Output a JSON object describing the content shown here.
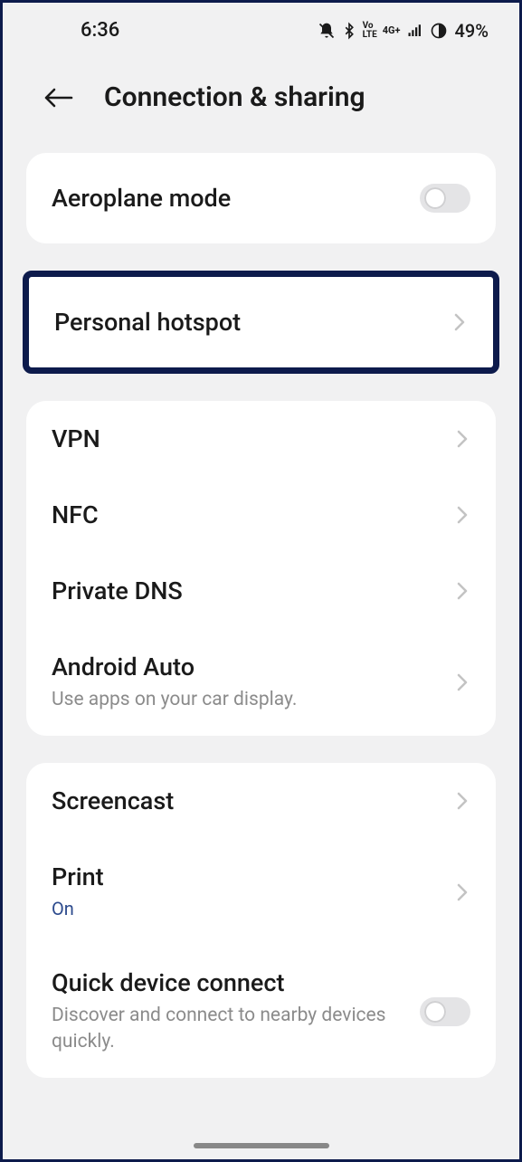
{
  "statusbar": {
    "time": "6:36",
    "battery": "49%"
  },
  "header": {
    "title": "Connection & sharing"
  },
  "aeroplane": {
    "label": "Aeroplane mode"
  },
  "hotspot": {
    "label": "Personal hotspot"
  },
  "vpn": {
    "label": "VPN"
  },
  "nfc": {
    "label": "NFC"
  },
  "dns": {
    "label": "Private DNS"
  },
  "auto": {
    "label": "Android Auto",
    "sub": "Use apps on your car display."
  },
  "screencast": {
    "label": "Screencast"
  },
  "print": {
    "label": "Print",
    "sub": "On"
  },
  "quick": {
    "label": "Quick device connect",
    "sub": "Discover and connect to nearby devices quickly."
  }
}
